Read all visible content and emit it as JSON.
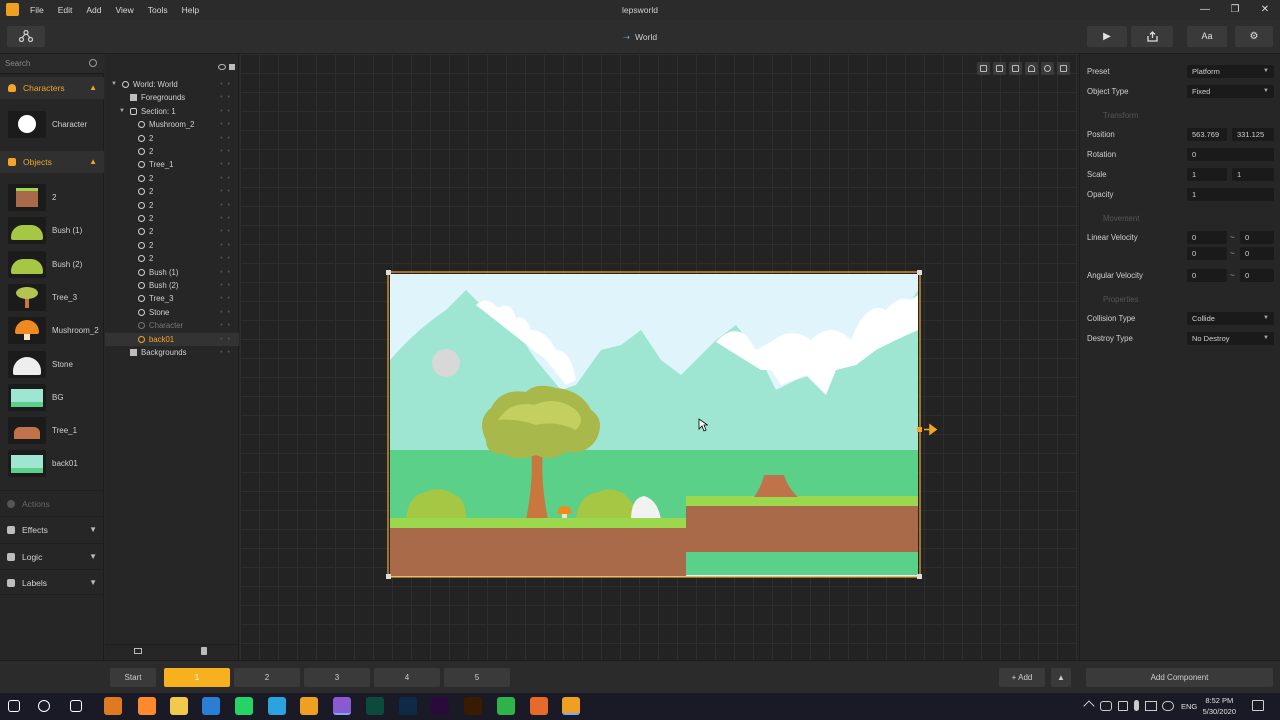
{
  "app": {
    "title": "lepsworld",
    "menu": [
      "File",
      "Edit",
      "Add",
      "View",
      "Tools",
      "Help"
    ],
    "window_controls": [
      "—",
      "❐",
      "✕"
    ]
  },
  "toolbar": {
    "breadcrumb": "World",
    "font_button": "Aa"
  },
  "palette": {
    "search_placeholder": "Search",
    "characters_label": "Characters",
    "character_item": "Character",
    "objects_label": "Objects",
    "objects": [
      {
        "label": "2",
        "kind": "ground"
      },
      {
        "label": "Bush (1)",
        "kind": "bush"
      },
      {
        "label": "Bush (2)",
        "kind": "bush"
      },
      {
        "label": "Tree_3",
        "kind": "tree"
      },
      {
        "label": "Mushroom_2",
        "kind": "mushroom"
      },
      {
        "label": "Stone",
        "kind": "stone"
      },
      {
        "label": "BG",
        "kind": "bg"
      },
      {
        "label": "Tree_1",
        "kind": "stump"
      },
      {
        "label": "back01",
        "kind": "bg"
      }
    ],
    "actions_label": "Actions",
    "effects_label": "Effects",
    "logic_label": "Logic",
    "labels_label": "Labels"
  },
  "hierarchy": {
    "rows": [
      {
        "label": "World: World",
        "indent": 0,
        "type": "world"
      },
      {
        "label": "Foregrounds",
        "indent": 1,
        "type": "layer"
      },
      {
        "label": "Section: 1",
        "indent": 1,
        "type": "section"
      },
      {
        "label": "Mushroom_2",
        "indent": 2,
        "type": "obj"
      },
      {
        "label": "2",
        "indent": 2,
        "type": "obj"
      },
      {
        "label": "2",
        "indent": 2,
        "type": "obj"
      },
      {
        "label": "Tree_1",
        "indent": 2,
        "type": "obj"
      },
      {
        "label": "2",
        "indent": 2,
        "type": "obj"
      },
      {
        "label": "2",
        "indent": 2,
        "type": "obj"
      },
      {
        "label": "2",
        "indent": 2,
        "type": "obj"
      },
      {
        "label": "2",
        "indent": 2,
        "type": "obj"
      },
      {
        "label": "2",
        "indent": 2,
        "type": "obj"
      },
      {
        "label": "2",
        "indent": 2,
        "type": "obj"
      },
      {
        "label": "2",
        "indent": 2,
        "type": "obj"
      },
      {
        "label": "Bush (1)",
        "indent": 2,
        "type": "obj"
      },
      {
        "label": "Bush (2)",
        "indent": 2,
        "type": "obj"
      },
      {
        "label": "Tree_3",
        "indent": 2,
        "type": "obj"
      },
      {
        "label": "Stone",
        "indent": 2,
        "type": "obj"
      },
      {
        "label": "Character",
        "indent": 2,
        "type": "char"
      },
      {
        "label": "back01",
        "indent": 2,
        "type": "selected"
      },
      {
        "label": "Backgrounds",
        "indent": 1,
        "type": "layer"
      }
    ]
  },
  "inspector": {
    "preset_label": "Preset",
    "preset_value": "Platform",
    "object_type_label": "Object Type",
    "object_type_value": "Fixed",
    "transform_label": "Transform",
    "position_label": "Position",
    "position_x": "563.769",
    "position_y": "331.125",
    "rotation_label": "Rotation",
    "rotation_value": "0",
    "scale_label": "Scale",
    "scale_x": "1",
    "scale_y": "1",
    "opacity_label": "Opacity",
    "opacity_value": "1",
    "movement_label": "Movement",
    "linear_velocity_label": "Linear Velocity",
    "lv": [
      "0",
      "0",
      "0",
      "0"
    ],
    "angular_velocity_label": "Angular Velocity",
    "av": [
      "0",
      "0"
    ],
    "tilde": "~",
    "properties_label": "Properties",
    "collision_type_label": "Collision Type",
    "collision_type_value": "Collide",
    "destroy_type_label": "Destroy Type",
    "destroy_type_value": "No Destroy",
    "add_component_label": "Add Component"
  },
  "bottombar": {
    "start_label": "Start",
    "tabs": [
      "1",
      "2",
      "3",
      "4",
      "5"
    ],
    "add_label": "+ Add"
  },
  "taskbar": {
    "lang": "ENG",
    "time": "8:52 PM",
    "date": "5/30/2020",
    "apps": [
      {
        "name": "windows-start",
        "color": "#ffffff"
      },
      {
        "name": "cortana",
        "color": "#ffffff"
      },
      {
        "name": "task-view",
        "color": "#ffffff"
      },
      {
        "name": "firefox-dev",
        "color": "#e07a20"
      },
      {
        "name": "firefox",
        "color": "#ff8a2b"
      },
      {
        "name": "file-explorer",
        "color": "#f2c94c"
      },
      {
        "name": "store",
        "color": "#2a7fd4"
      },
      {
        "name": "whatsapp",
        "color": "#25d366"
      },
      {
        "name": "telegram",
        "color": "#2aa3df"
      },
      {
        "name": "notepad",
        "color": "#f0a020"
      },
      {
        "name": "visual-studio",
        "color": "#8a5ad0"
      },
      {
        "name": "audition",
        "color": "#0c4a3c"
      },
      {
        "name": "photoshop",
        "color": "#0e2a47"
      },
      {
        "name": "premiere",
        "color": "#2a0a3a"
      },
      {
        "name": "illustrator",
        "color": "#3a1a00"
      },
      {
        "name": "camtasia",
        "color": "#2db34a"
      },
      {
        "name": "orange-app",
        "color": "#e86a2a"
      },
      {
        "name": "buildbox",
        "color": "#f0a020"
      }
    ]
  }
}
